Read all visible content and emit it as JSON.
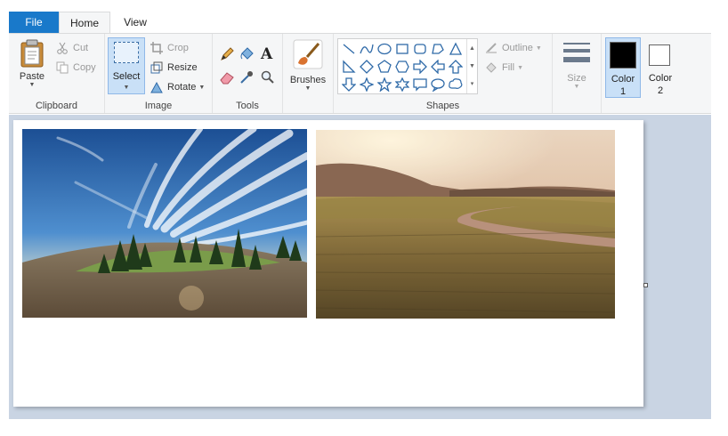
{
  "tabs": {
    "file": "File",
    "home": "Home",
    "view": "View"
  },
  "clipboard": {
    "paste": "Paste",
    "cut": "Cut",
    "copy": "Copy",
    "label": "Clipboard"
  },
  "image": {
    "select": "Select",
    "crop": "Crop",
    "resize": "Resize",
    "rotate": "Rotate",
    "label": "Image"
  },
  "tools": {
    "label": "Tools"
  },
  "brushes": {
    "label": "Brushes"
  },
  "shapes": {
    "outline": "Outline",
    "fill": "Fill",
    "label": "Shapes"
  },
  "size": {
    "label": "Size"
  },
  "colors": {
    "color1_label": "Color",
    "color1_num": "1",
    "color2_label": "Color",
    "color2_num": "2",
    "color1_value": "#000000",
    "color2_value": "#ffffff"
  },
  "theme": {
    "accent": "#1979ca",
    "ribbon_bg": "#f5f6f7",
    "workspace_bg": "#c9d4e3",
    "selected_bg": "#c9e0f7"
  },
  "canvas_images": [
    {
      "subject": "sky with streaking clouds over a curved hill with trees"
    },
    {
      "subject": "sunlit field with a winding dirt road and hills"
    }
  ]
}
